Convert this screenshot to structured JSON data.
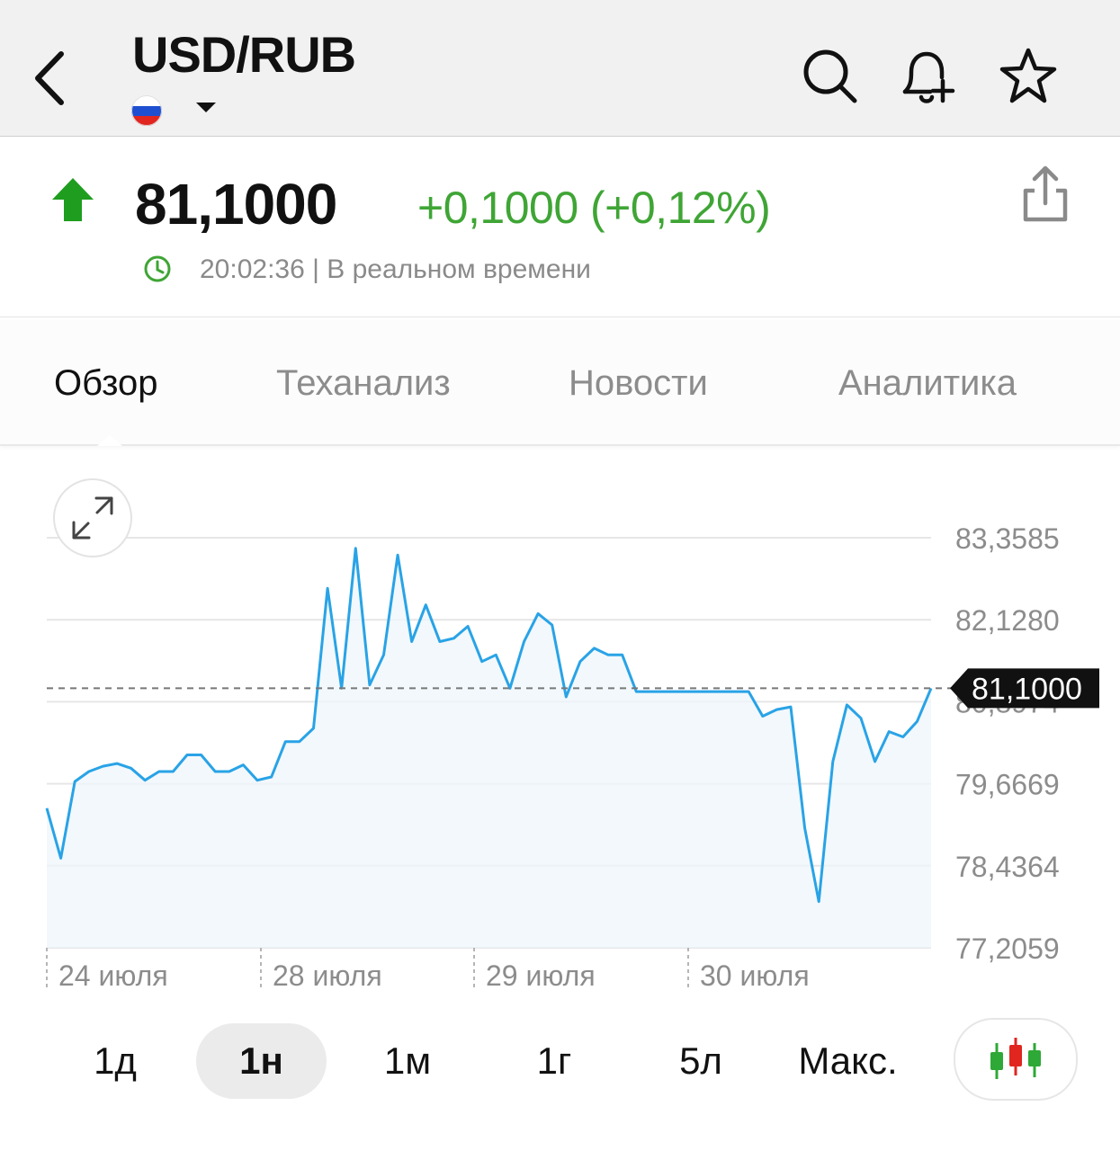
{
  "header": {
    "title": "USD/RUB",
    "back_icon": "chevron-left-icon",
    "flag": "russia-flag-icon",
    "actions": [
      "search-icon",
      "bell-plus-icon",
      "star-icon"
    ]
  },
  "quote": {
    "price": "81,1000",
    "change": "+0,1000 (+0,12%)",
    "direction": "up",
    "time_text": "20:02:36 | В реальном времени",
    "colors": {
      "up": "#3fa535",
      "arrow": "#1f9d1f"
    }
  },
  "tabs": [
    {
      "label": "Обзор",
      "active": true
    },
    {
      "label": "Теханализ",
      "active": false
    },
    {
      "label": "Новости",
      "active": false
    },
    {
      "label": "Аналитика",
      "active": false
    }
  ],
  "chart_data": {
    "type": "area",
    "y_ticks": [
      "83,3585",
      "82,1280",
      "80,8974",
      "79,6669",
      "78,4364",
      "77,2059"
    ],
    "y_tick_values": [
      83.3585,
      82.128,
      80.8974,
      79.6669,
      78.4364,
      77.2059
    ],
    "ylim": [
      77.2059,
      83.3585
    ],
    "x_ticks": [
      "24 июля",
      "28 июля",
      "29 июля",
      "30 июля"
    ],
    "current_label": "81,1000",
    "current_value": 81.1,
    "line_color": "#29a3e6",
    "series": [
      {
        "values": [
          79.3,
          78.55,
          79.7,
          79.85,
          79.93,
          79.97,
          79.9,
          79.72,
          79.85,
          79.85,
          80.1,
          80.1,
          79.85,
          79.85,
          79.95,
          79.72,
          79.77,
          80.3,
          80.3,
          80.5,
          82.6,
          81.1,
          83.2,
          81.15,
          81.6,
          83.1,
          81.8,
          82.35,
          81.8,
          81.85,
          82.03,
          81.5,
          81.6,
          81.1,
          81.8,
          82.22,
          82.05,
          80.97,
          81.5,
          81.7,
          81.6,
          81.6,
          81.05,
          81.05,
          81.05,
          81.05,
          81.05,
          81.05,
          81.05,
          81.05,
          81.05,
          80.68,
          80.78,
          80.82,
          79.0,
          77.9,
          80.0,
          80.85,
          80.65,
          80.0,
          80.45,
          80.37,
          80.6,
          81.1
        ]
      }
    ]
  },
  "ranges": [
    {
      "label": "1д",
      "active": false
    },
    {
      "label": "1н",
      "active": true
    },
    {
      "label": "1м",
      "active": false
    },
    {
      "label": "1г",
      "active": false
    },
    {
      "label": "5л",
      "active": false
    },
    {
      "label": "Макс.",
      "active": false
    }
  ],
  "icons": {
    "expand": "expand-arrows-icon",
    "candles": "candlestick-icon",
    "share": "share-icon",
    "clock": "clock-icon"
  }
}
